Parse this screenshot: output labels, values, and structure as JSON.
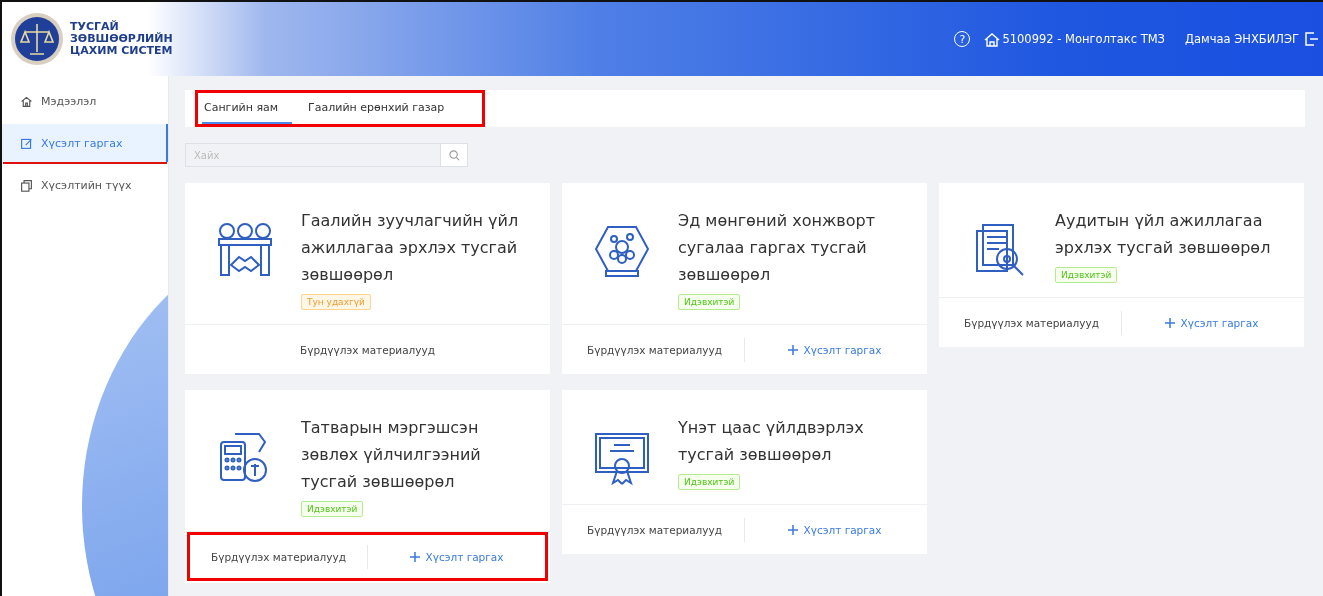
{
  "header": {
    "logo_text": [
      "ТУСГАЙ",
      "ЗӨВШӨӨРЛИЙН",
      "ЦАХИМ СИСТЕМ"
    ],
    "help": "?",
    "organization": "5100992 - Монголтакс ТМЗ",
    "user": "Дамчаа ЭНХБИЛЭГ"
  },
  "sidebar": {
    "items": [
      {
        "label": "Мэдээлэл",
        "selected": false,
        "highlighted": false
      },
      {
        "label": "Хүсэлт гаргах",
        "selected": true,
        "highlighted": true
      },
      {
        "label": "Хүсэлтийн түүх",
        "selected": false,
        "highlighted": false
      }
    ]
  },
  "tabs": {
    "highlighted": true,
    "items": [
      {
        "label": "Сангийн яам",
        "selected": true
      },
      {
        "label": "Гаалийн ерөнхий газар",
        "selected": false
      }
    ]
  },
  "search": {
    "placeholder": "Хайх"
  },
  "cards": [
    {
      "title": "Гаалийн зуучлагчийн үйл ажиллагаа эрхлэх тусгай зөвшөөрөл",
      "badge": {
        "label": "Тун удахгүй",
        "kind": "warning"
      },
      "materials": "Бүрдүүлэх материалууд",
      "highlighted": false
    },
    {
      "title": "Эд мөнгөний хонжворт сугалаа гаргах тусгай зөвшөөрөл",
      "badge": {
        "label": "Идэвхитэй",
        "kind": "success"
      },
      "materials": "Бүрдүүлэх материалууд",
      "apply": "Хүсэлт гаргах",
      "highlighted": false
    },
    {
      "title": "Аудитын үйл ажиллагаа эрхлэх тусгай зөвшөөрөл",
      "badge": {
        "label": "Идэвхитэй",
        "kind": "success"
      },
      "materials": "Бүрдүүлэх материалууд",
      "apply": "Хүсэлт гаргах",
      "highlighted": false
    },
    {
      "title": "Татварын мэргэшсэн зөвлөх үйлчилгээний тусгай зөвшөөрөл",
      "badge": {
        "label": "Идэвхитэй",
        "kind": "success"
      },
      "materials": "Бүрдүүлэх материалууд",
      "apply": "Хүсэлт гаргах",
      "highlighted": true
    },
    {
      "title": "Үнэт цаас үйлдвэрлэх тусгай зөвшөөрөл",
      "badge": {
        "label": "Идэвхитэй",
        "kind": "success"
      },
      "materials": "Бүрдүүлэх материалууд",
      "apply": "Хүсэлт гаргах",
      "highlighted": false
    }
  ]
}
